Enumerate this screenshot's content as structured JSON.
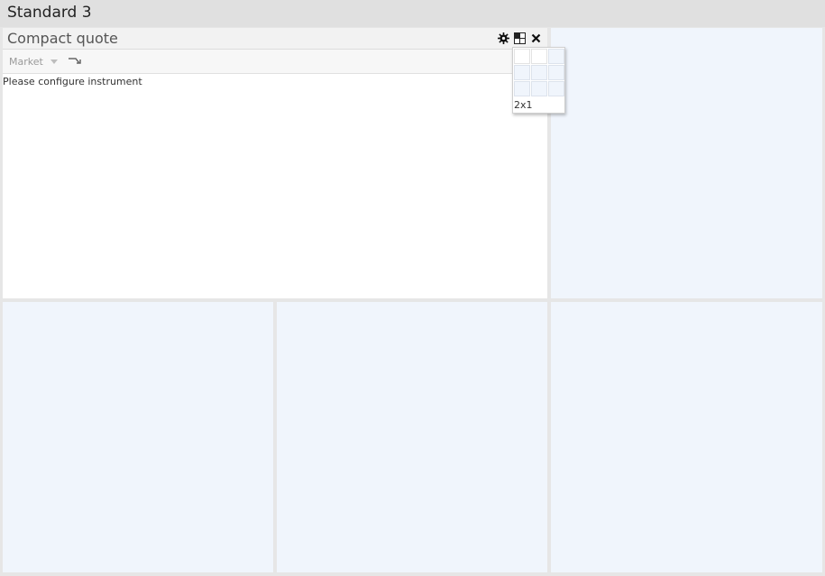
{
  "header": {
    "title": "Standard 3"
  },
  "widget": {
    "title": "Compact quote",
    "icons": [
      "gear-icon",
      "layout-icon",
      "close-icon"
    ],
    "toolbar": {
      "market_label": "Market",
      "route_icon": "route-arrow-icon"
    },
    "message": "Please configure instrument"
  },
  "layout_popup": {
    "rows": 3,
    "cols": 3,
    "selected_size": "2x1",
    "label": "2x1"
  },
  "colors": {
    "empty_cell": "#f0f5fc",
    "background": "#e6e6e6",
    "header": "#e0e0e0"
  }
}
